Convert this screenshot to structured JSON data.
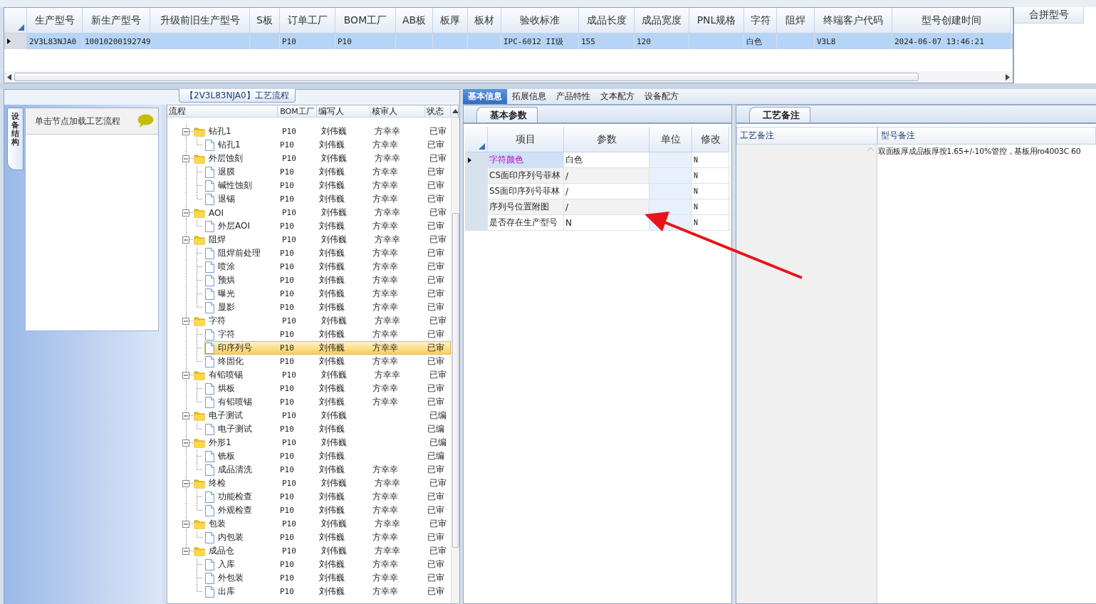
{
  "top_grid": {
    "columns": [
      "生产型号",
      "新生产型号",
      "升级前旧生产型号",
      "S板",
      "订单工厂",
      "BOM工厂",
      "AB板",
      "板厚",
      "板材",
      "验收标准",
      "成品长度",
      "成品宽度",
      "PNL规格",
      "字符",
      "阻焊",
      "终端客户代码",
      "型号创建时间"
    ],
    "rows": [
      {
        "selected": true,
        "cells": [
          "2V3L83NJA0",
          "10010200192749",
          "",
          "",
          "P10",
          "P10",
          "",
          "",
          "",
          "IPC-6012 II级",
          "155",
          "120",
          "",
          "白色",
          "",
          "V3L8",
          "2024-06-07 13:46:21"
        ]
      }
    ]
  },
  "merge_panel": {
    "columns": [
      "合拼型号"
    ]
  },
  "process_panel": {
    "title": "【2V3L83NJA0】工艺流程",
    "side_tab": "设备结构",
    "hint": "单击节点加载工艺流程",
    "tree": {
      "columns": [
        "流程",
        "BOM工厂",
        "编写人",
        "核审人",
        "状态"
      ],
      "rows": [
        {
          "label": "钻孔1",
          "bom": "P10",
          "writer": "刘伟巍",
          "reviewer": "方幸幸",
          "status": "已审",
          "selected": false,
          "expanded": true,
          "children": [
            {
              "label": "钻孔1",
              "bom": "P10",
              "writer": "刘伟巍",
              "reviewer": "方幸幸",
              "status": "已审",
              "selected": false
            }
          ]
        },
        {
          "label": "外层蚀刻",
          "bom": "P10",
          "writer": "刘伟巍",
          "reviewer": "方幸幸",
          "status": "已审",
          "selected": false,
          "expanded": true,
          "children": [
            {
              "label": "退膜",
              "bom": "P10",
              "writer": "刘伟巍",
              "reviewer": "方幸幸",
              "status": "已审",
              "selected": false
            },
            {
              "label": "碱性蚀刻",
              "bom": "P10",
              "writer": "刘伟巍",
              "reviewer": "方幸幸",
              "status": "已审",
              "selected": false
            },
            {
              "label": "退锡",
              "bom": "P10",
              "writer": "刘伟巍",
              "reviewer": "方幸幸",
              "status": "已审",
              "selected": false
            }
          ]
        },
        {
          "label": "AOI",
          "bom": "P10",
          "writer": "刘伟巍",
          "reviewer": "方幸幸",
          "status": "已审",
          "selected": false,
          "expanded": true,
          "children": [
            {
              "label": "外层AOI",
              "bom": "P10",
              "writer": "刘伟巍",
              "reviewer": "方幸幸",
              "status": "已审",
              "selected": false
            }
          ]
        },
        {
          "label": "阻焊",
          "bom": "P10",
          "writer": "刘伟巍",
          "reviewer": "方幸幸",
          "status": "已审",
          "selected": false,
          "expanded": true,
          "children": [
            {
              "label": "阻焊前处理",
              "bom": "P10",
              "writer": "刘伟巍",
              "reviewer": "方幸幸",
              "status": "已审",
              "selected": false
            },
            {
              "label": "喷涂",
              "bom": "P10",
              "writer": "刘伟巍",
              "reviewer": "方幸幸",
              "status": "已审",
              "selected": false
            },
            {
              "label": "预烘",
              "bom": "P10",
              "writer": "刘伟巍",
              "reviewer": "方幸幸",
              "status": "已审",
              "selected": false
            },
            {
              "label": "曝光",
              "bom": "P10",
              "writer": "刘伟巍",
              "reviewer": "方幸幸",
              "status": "已审",
              "selected": false
            },
            {
              "label": "显影",
              "bom": "P10",
              "writer": "刘伟巍",
              "reviewer": "方幸幸",
              "status": "已审",
              "selected": false
            }
          ]
        },
        {
          "label": "字符",
          "bom": "P10",
          "writer": "刘伟巍",
          "reviewer": "方幸幸",
          "status": "已审",
          "selected": false,
          "expanded": true,
          "children": [
            {
              "label": "字符",
              "bom": "P10",
              "writer": "刘伟巍",
              "reviewer": "方幸幸",
              "status": "已审",
              "selected": false
            },
            {
              "label": "印序列号",
              "bom": "P10",
              "writer": "刘伟巍",
              "reviewer": "方幸幸",
              "status": "已审",
              "selected": true
            },
            {
              "label": "终固化",
              "bom": "P10",
              "writer": "刘伟巍",
              "reviewer": "方幸幸",
              "status": "已审",
              "selected": false
            }
          ]
        },
        {
          "label": "有铅喷锡",
          "bom": "P10",
          "writer": "刘伟巍",
          "reviewer": "方幸幸",
          "status": "已审",
          "selected": false,
          "expanded": true,
          "children": [
            {
              "label": "烘板",
              "bom": "P10",
              "writer": "刘伟巍",
              "reviewer": "方幸幸",
              "status": "已审",
              "selected": false
            },
            {
              "label": "有铅喷锡",
              "bom": "P10",
              "writer": "刘伟巍",
              "reviewer": "方幸幸",
              "status": "已审",
              "selected": false
            }
          ]
        },
        {
          "label": "电子测试",
          "bom": "P10",
          "writer": "刘伟巍",
          "status": "已编",
          "selected": false,
          "expanded": true,
          "children": [
            {
              "label": "电子测试",
              "bom": "P10",
              "writer": "刘伟巍",
              "status": "已编",
              "selected": false
            }
          ]
        },
        {
          "label": "外形1",
          "bom": "P10",
          "writer": "刘伟巍",
          "status": "已编",
          "selected": false,
          "expanded": true,
          "children": [
            {
              "label": "铣板",
              "bom": "P10",
              "writer": "刘伟巍",
              "status": "已编",
              "selected": false
            },
            {
              "label": "成品清洗",
              "bom": "P10",
              "writer": "刘伟巍",
              "reviewer": "方幸幸",
              "status": "已审",
              "selected": false
            }
          ]
        },
        {
          "label": "终检",
          "bom": "P10",
          "writer": "刘伟巍",
          "reviewer": "方幸幸",
          "status": "已审",
          "selected": false,
          "expanded": true,
          "children": [
            {
              "label": "功能检查",
              "bom": "P10",
              "writer": "刘伟巍",
              "reviewer": "方幸幸",
              "status": "已审",
              "selected": false
            },
            {
              "label": "外观检查",
              "bom": "P10",
              "writer": "刘伟巍",
              "reviewer": "方幸幸",
              "status": "已审",
              "selected": false
            }
          ]
        },
        {
          "label": "包装",
          "bom": "P10",
          "writer": "刘伟巍",
          "reviewer": "方幸幸",
          "status": "已审",
          "selected": false,
          "expanded": true,
          "children": [
            {
              "label": "内包装",
              "bom": "P10",
              "writer": "刘伟巍",
              "reviewer": "方幸幸",
              "status": "已审",
              "selected": false
            }
          ]
        },
        {
          "label": "成品仓",
          "bom": "P10",
          "writer": "刘伟巍",
          "reviewer": "方幸幸",
          "status": "已审",
          "selected": false,
          "expanded": true,
          "children": [
            {
              "label": "入库",
              "bom": "P10",
              "writer": "刘伟巍",
              "reviewer": "方幸幸",
              "status": "已审",
              "selected": false
            },
            {
              "label": "外包装",
              "bom": "P10",
              "writer": "刘伟巍",
              "reviewer": "方幸幸",
              "status": "已审",
              "selected": false
            },
            {
              "label": "出库",
              "bom": "P10",
              "writer": "刘伟巍",
              "reviewer": "方幸幸",
              "status": "已审",
              "selected": false
            }
          ]
        }
      ]
    }
  },
  "detail_tabs": [
    {
      "label": "基本信息",
      "selected": true
    },
    {
      "label": "拓展信息",
      "selected": false
    },
    {
      "label": "产品特性",
      "selected": false
    },
    {
      "label": "文本配方",
      "selected": false
    },
    {
      "label": "设备配方",
      "selected": false
    }
  ],
  "params_panel": {
    "tab": "基本参数",
    "columns": [
      "项目",
      "参数",
      "单位",
      "修改"
    ],
    "rows": [
      {
        "item": "字符颜色",
        "value": "白色",
        "modified": "N",
        "selected": true
      },
      {
        "item": "CS面印序列号菲林",
        "value": "/",
        "modified": "N",
        "selected": false
      },
      {
        "item": "SS面印序列号菲林",
        "value": "/",
        "modified": "N",
        "selected": false
      },
      {
        "item": "序列号位置附图",
        "value": "/",
        "modified": "N",
        "selected": false
      },
      {
        "item": "是否存在生产型号",
        "value": "N",
        "modified": "N",
        "selected": false
      }
    ]
  },
  "notes_panel": {
    "tab": "工艺备注",
    "columns": [
      "工艺备注",
      "型号备注"
    ],
    "model_note": "双面板厚成品板厚按1.65+/-10%管控，基板用ro4003C 60"
  }
}
